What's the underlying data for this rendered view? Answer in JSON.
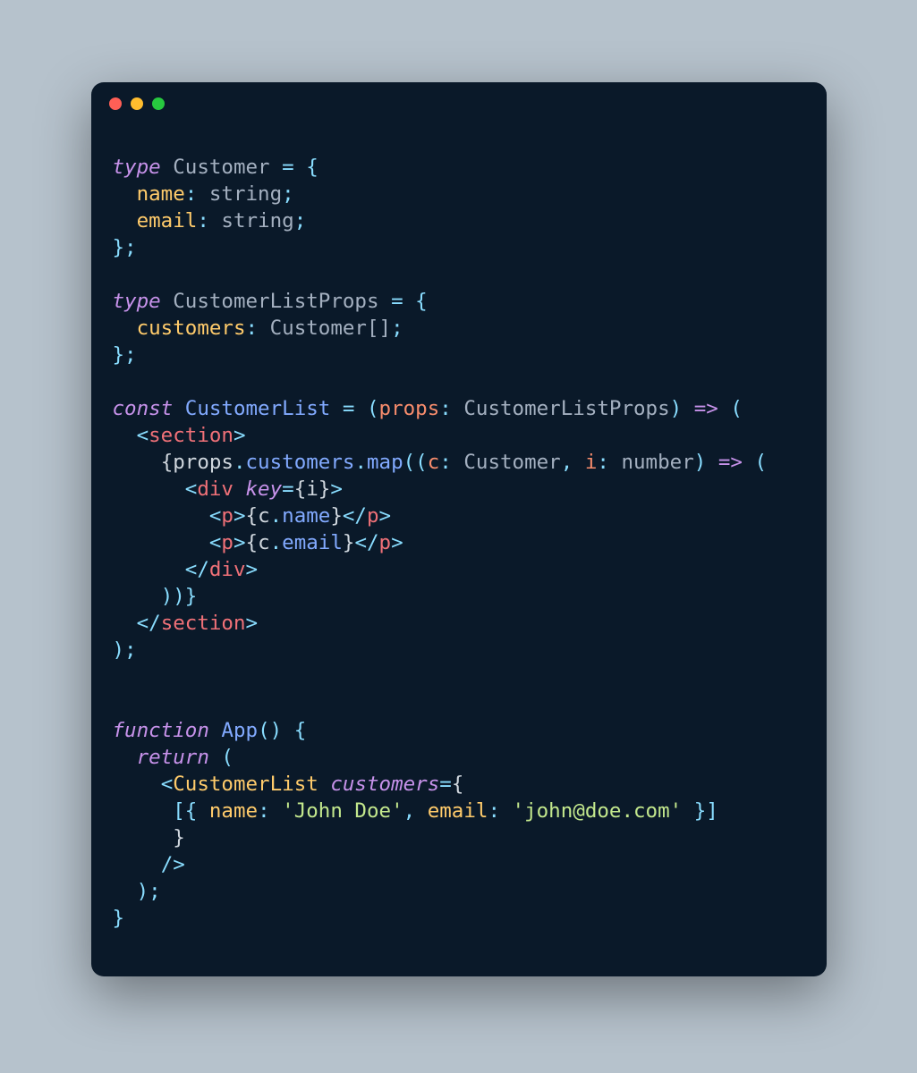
{
  "code": {
    "tokens": {
      "type_kw": "type",
      "customer": "Customer",
      "eq_brace": " = {",
      "name_prop": "name",
      "email_prop": "email",
      "colon_space": ": ",
      "string_type": "string",
      "semicolon": ";",
      "close_brace_semi": "};",
      "customer_list_props": "CustomerListProps",
      "customers_prop": "customers",
      "customer_array": "Customer[]",
      "const_kw": "const",
      "customer_list": "CustomerList",
      "eq_paren": " = (",
      "props_param": "props",
      "close_paren_space": ") ",
      "arrow": "=>",
      "space_paren": " (",
      "open_angle": "<",
      "close_angle": ">",
      "section_tag": "section",
      "open_embed": "{",
      "close_embed": "}",
      "props_var": "props",
      "dot": ".",
      "customers_access": "customers",
      "map_fn": "map",
      "open_paren": "(",
      "close_paren": ")",
      "c_param": "c",
      "i_param": "i",
      "comma_space": ", ",
      "number_type": "number",
      "div_tag": "div",
      "key_attr": "key",
      "p_tag": "p",
      "name_access": "name",
      "email_access": "email",
      "close_tag_prefix": "</",
      "close_paren_paren_brace": "))}",
      "close_paren_semi": ");",
      "function_kw": "function",
      "app_fn": "App",
      "empty_parens": "()",
      "space_brace": " {",
      "return_kw": "return",
      "customer_list_comp": "CustomerList",
      "customers_attr": "customers",
      "open_bracket": "[",
      "close_bracket": "]",
      "john_doe": "'John Doe'",
      "john_email": "'john@doe.com'",
      "self_close": "/>",
      "close_brace": "}",
      "space": " ",
      "indent2": "  ",
      "indent4": "    ",
      "indent5": "     ",
      "indent6": "      ",
      "indent8": "        "
    }
  }
}
